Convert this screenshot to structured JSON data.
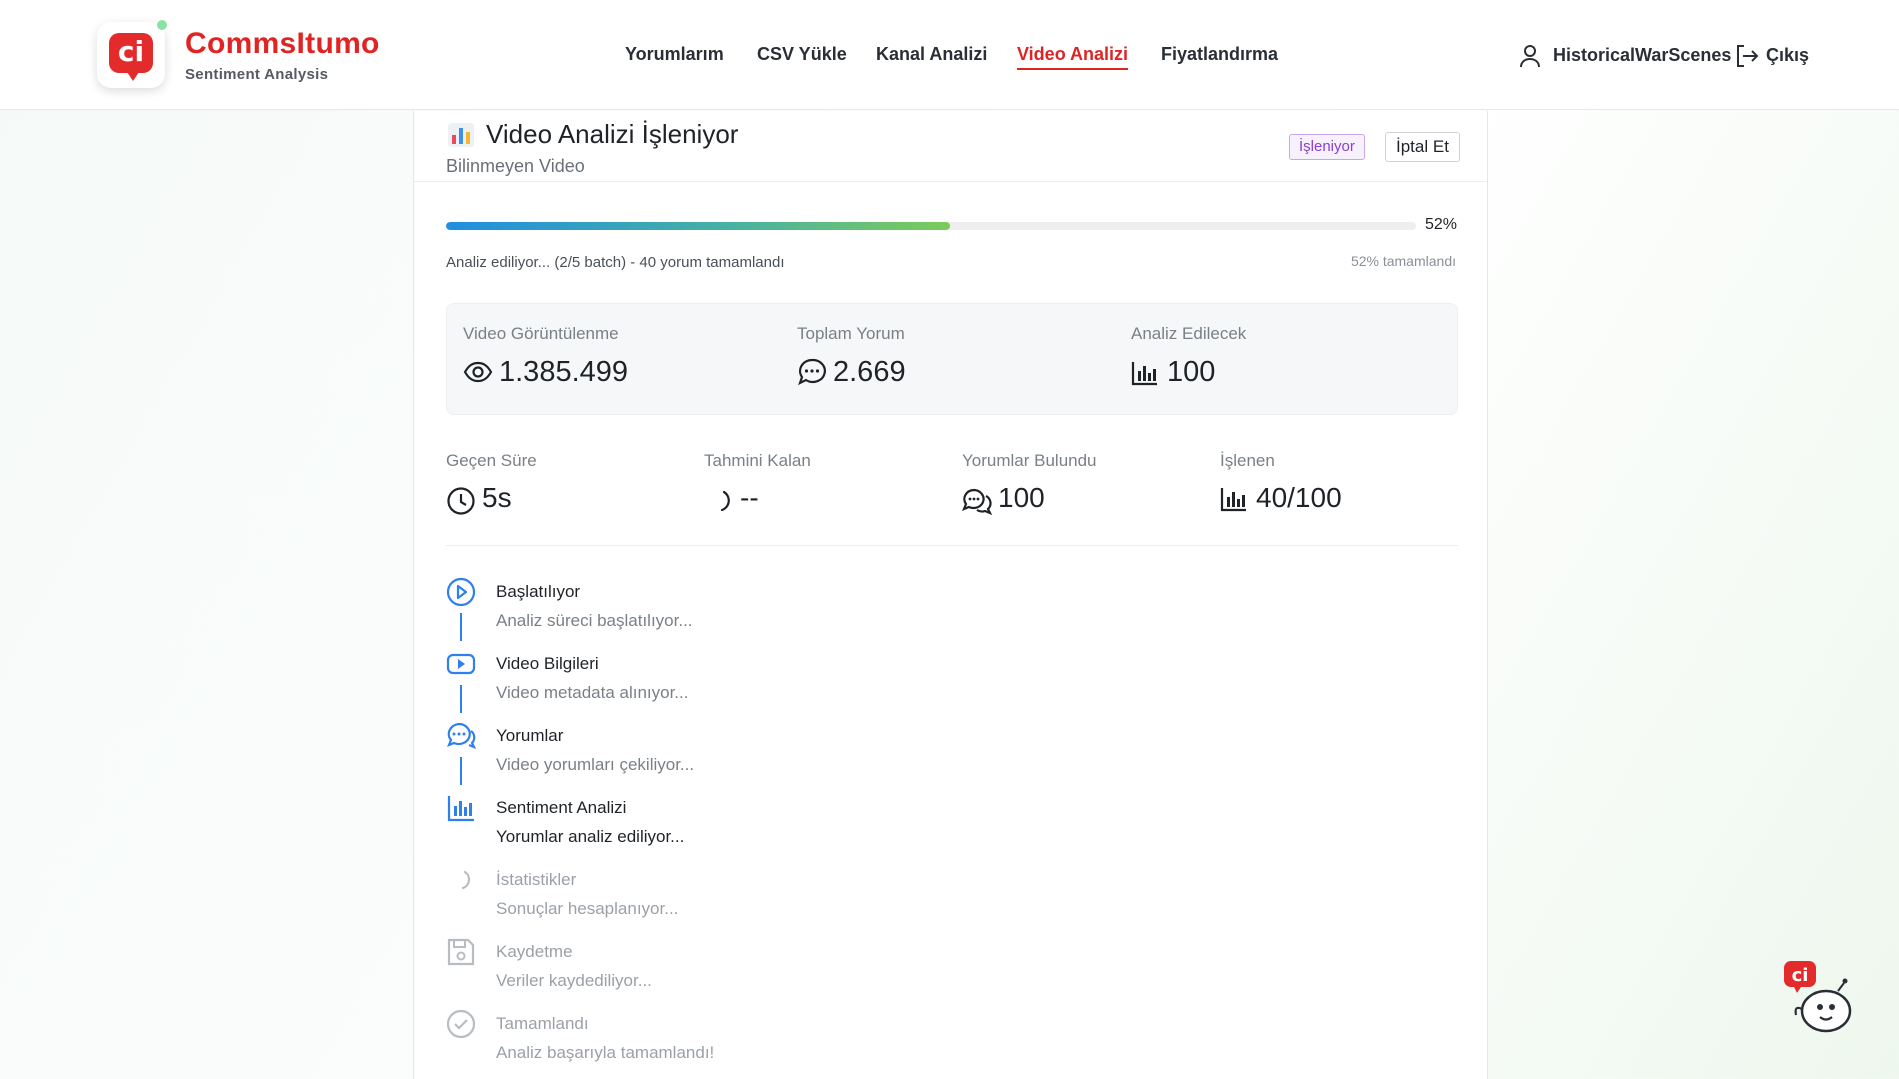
{
  "brand": {
    "name": "CommsItumo",
    "tagline": "Sentiment Analysis",
    "logo_text": "ci",
    "accent": "#e02424"
  },
  "nav": {
    "items": [
      {
        "label": "Yorumlarım"
      },
      {
        "label": "CSV Yükle"
      },
      {
        "label": "Kanal Analizi"
      },
      {
        "label": "Video Analizi",
        "active": true
      },
      {
        "label": "Fiyatlandırma"
      }
    ]
  },
  "user": {
    "name": "HistoricalWarScenes",
    "logout_label": "Çıkış",
    "icon": "user-icon",
    "logout_icon": "logout-icon"
  },
  "card": {
    "title_icon": "bar-chart-emoji-icon",
    "title": "Video Analizi İşleniyor",
    "subtitle": "Bilinmeyen Video",
    "badge": "İşleniyor",
    "cancel_label": "İptal Et"
  },
  "progress": {
    "percent": 52,
    "percent_label": "52%",
    "status": "Analiz ediliyor... (2/5 batch) - 40 yorum tamamlandı",
    "done_label": "52% tamamlandı"
  },
  "stats": [
    {
      "label": "Video Görüntülenme",
      "value": "1.385.499",
      "icon": "eye-icon"
    },
    {
      "label": "Toplam Yorum",
      "value": "2.669",
      "icon": "comment-icon"
    },
    {
      "label": "Analiz Edilecek",
      "value": "100",
      "icon": "bar-chart-icon"
    }
  ],
  "meta": [
    {
      "label": "Geçen Süre",
      "value": "5s",
      "icon": "clock-icon"
    },
    {
      "label": "Tahmini Kalan",
      "value": "--",
      "icon": "spinner-icon"
    },
    {
      "label": "Yorumlar Bulundu",
      "value": "100",
      "icon": "comments-icon"
    },
    {
      "label": "İşlenen",
      "value": "40/100",
      "icon": "bar-chart-icon"
    }
  ],
  "steps": [
    {
      "title": "Başlatılıyor",
      "desc": "Analiz süreci başlatılıyor...",
      "state": "done",
      "icon": "play-circle-icon"
    },
    {
      "title": "Video Bilgileri",
      "desc": "Video metadata alınıyor...",
      "state": "done",
      "icon": "youtube-icon"
    },
    {
      "title": "Yorumlar",
      "desc": "Video yorumları çekiliyor...",
      "state": "done",
      "icon": "comments-icon"
    },
    {
      "title": "Sentiment Analizi",
      "desc": "Yorumlar analiz ediliyor...",
      "state": "active",
      "icon": "bar-chart-icon"
    },
    {
      "title": "İstatistikler",
      "desc": "Sonuçlar hesaplanıyor...",
      "state": "pending",
      "icon": "spinner-icon"
    },
    {
      "title": "Kaydetme",
      "desc": "Veriler kaydediliyor...",
      "state": "pending",
      "icon": "save-icon"
    },
    {
      "title": "Tamamlandı",
      "desc": "Analiz başarıyla tamamlandı!",
      "state": "pending",
      "icon": "check-circle-icon"
    }
  ],
  "colors": {
    "primary_blue": "#2f80ed",
    "pending_gray": "#b8bdc2",
    "badge_purple": "#8a3fcf"
  }
}
